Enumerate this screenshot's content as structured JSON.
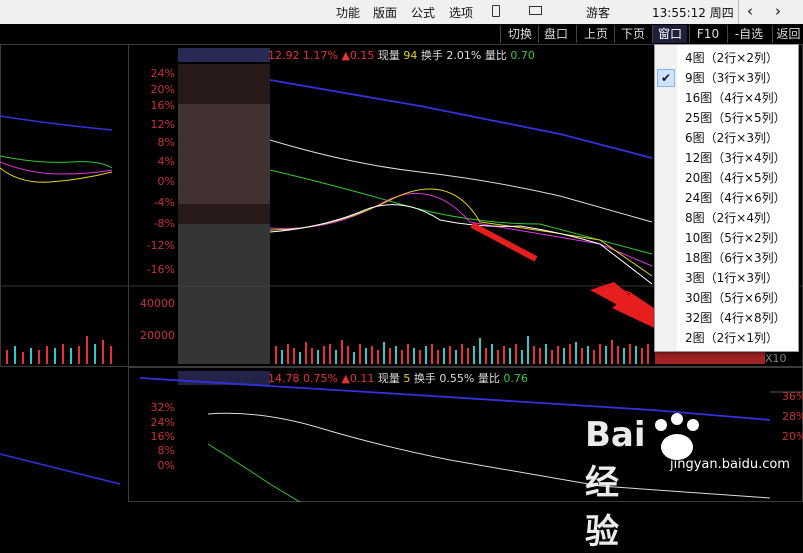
{
  "topbar": {
    "menus": [
      "功能",
      "版面",
      "公式",
      "选项"
    ],
    "tablet_icon": "tablet-icon",
    "mail_icon": "mail-icon",
    "guest": "游客",
    "time": "13:55:12 周四",
    "back_icon": "arrow-left-icon",
    "forward_icon": "arrow-right-icon"
  },
  "toolbar": {
    "buttons": [
      "切换",
      "盘口",
      "上页",
      "下页",
      "窗口",
      "F10",
      "-自选",
      "返回"
    ],
    "active": "窗口"
  },
  "chart1": {
    "header": {
      "price": "12.92",
      "pct": "1.17%",
      "change": "▲0.15",
      "vol_label": "现量",
      "vol": "94",
      "turnover_label": "换手",
      "turnover": "2.01%",
      "ratio_label": "量比",
      "ratio": "0.70"
    },
    "y_labels": [
      "24%",
      "20%",
      "16%",
      "12%",
      "8%",
      "4%",
      "0%",
      "-4%",
      "-8%",
      "-12%",
      "-16%"
    ],
    "vol_labels": [
      "40000",
      "20000"
    ]
  },
  "chart2": {
    "header": {
      "price": "14.78",
      "pct": "0.75%",
      "change": "▲0.11",
      "vol_label": "现量",
      "vol": "5",
      "turnover_label": "换手",
      "turnover": "0.55%",
      "ratio_label": "量比",
      "ratio": "0.76"
    },
    "y_labels": [
      "32%",
      "24%",
      "16%",
      "8%",
      "0%"
    ],
    "right_labels": [
      "36%",
      "28%",
      "20%"
    ]
  },
  "x10": "X10",
  "window_menu": {
    "items": [
      {
        "label": "4图（2行×2列）",
        "selected": false
      },
      {
        "label": "9图（3行×3列）",
        "selected": true
      },
      {
        "label": "16图（4行×4列）",
        "selected": false
      },
      {
        "label": "25图（5行×5列）",
        "selected": false
      },
      {
        "label": "6图（2行×3列）",
        "selected": false
      },
      {
        "label": "12图（3行×4列）",
        "selected": false
      },
      {
        "label": "20图（4行×5列）",
        "selected": false
      },
      {
        "label": "24图（4行×6列）",
        "selected": false
      },
      {
        "label": "8图（2行×4列）",
        "selected": false
      },
      {
        "label": "10图（5行×2列）",
        "selected": false
      },
      {
        "label": "18图（6行×3列）",
        "selected": false
      },
      {
        "label": "3图（1行×3列）",
        "selected": false
      },
      {
        "label": "30图（5行×6列）",
        "selected": false
      },
      {
        "label": "32图（4行×8列）",
        "selected": false
      },
      {
        "label": "2图（2行×1列）",
        "selected": false
      }
    ],
    "check_glyph": "✔"
  },
  "watermark": {
    "brand": "Bai经验",
    "url": "jingyan.baidu.com"
  },
  "colors": {
    "up": "#e63232",
    "down": "#32c8c8",
    "ma_white": "#ffffff",
    "ma_yellow": "#e6d21e",
    "ma_magenta": "#dc32dc",
    "ma_green": "#32c832",
    "ma_blue": "#3232dc",
    "annotation_red": "#e61e1e"
  }
}
